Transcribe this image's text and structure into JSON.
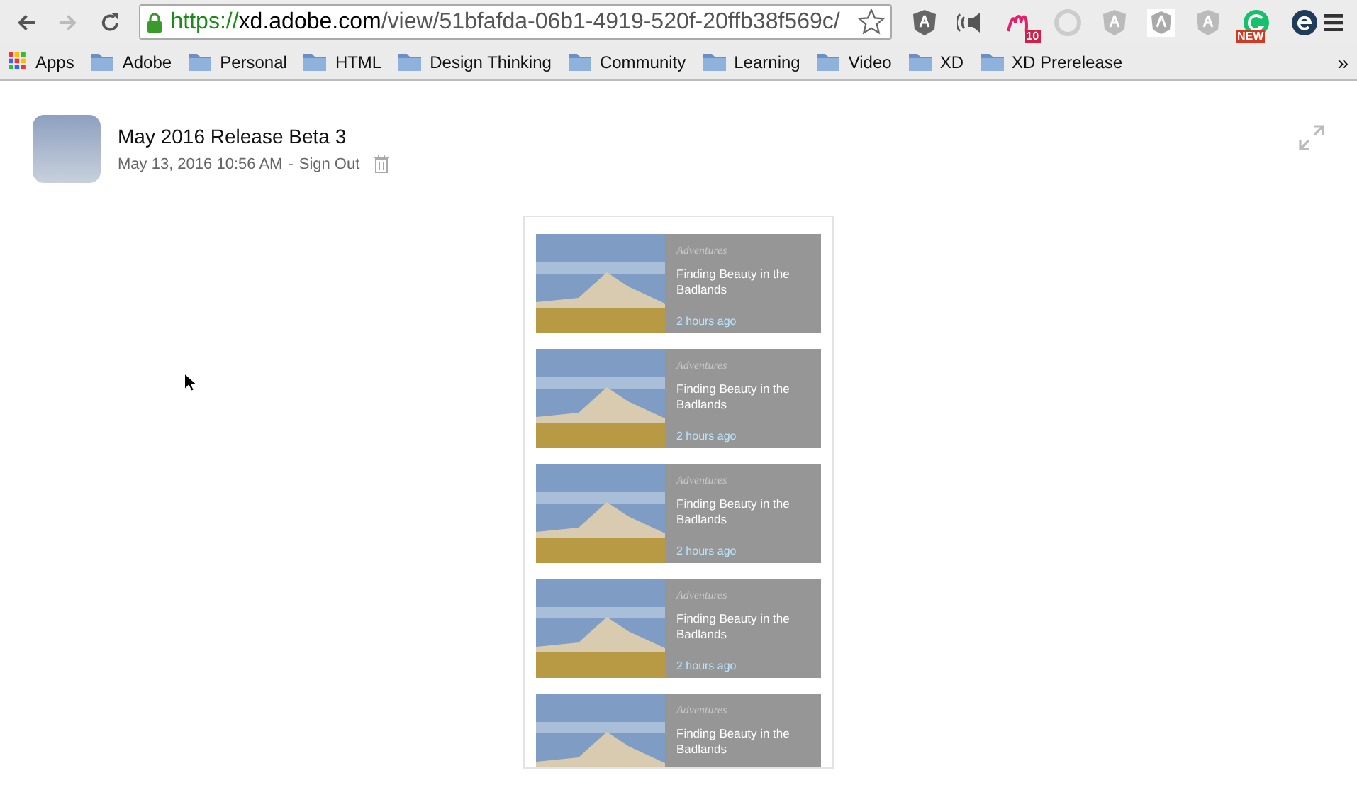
{
  "browser": {
    "url_scheme": "https://",
    "url_host": "xd.adobe.com",
    "url_path": "/view/51bfafda-06b1-4919-520f-20ffb38f569c/",
    "extensions": [
      {
        "kind": "shield"
      },
      {
        "kind": "speaker"
      },
      {
        "kind": "script",
        "badge": "10"
      },
      {
        "kind": "sync"
      },
      {
        "kind": "shield-faint"
      },
      {
        "kind": "shield-box"
      },
      {
        "kind": "shield-faint"
      },
      {
        "kind": "grammar",
        "badge": "NEW"
      },
      {
        "kind": "circle-e"
      }
    ],
    "bookmarks": [
      {
        "label": "Apps",
        "kind": "apps"
      },
      {
        "label": "Adobe",
        "kind": "folder"
      },
      {
        "label": "Personal",
        "kind": "folder"
      },
      {
        "label": "HTML",
        "kind": "folder"
      },
      {
        "label": "Design Thinking",
        "kind": "folder"
      },
      {
        "label": "Community",
        "kind": "folder"
      },
      {
        "label": "Learning",
        "kind": "folder"
      },
      {
        "label": "Video",
        "kind": "folder"
      },
      {
        "label": "XD",
        "kind": "folder"
      },
      {
        "label": "XD Prerelease",
        "kind": "folder"
      }
    ],
    "overflow": "»"
  },
  "header": {
    "title": "May 2016 Release Beta 3",
    "date": "May 13, 2016 10:56 AM",
    "separator": "-",
    "sign_out": "Sign Out"
  },
  "cards": [
    {
      "category": "Adventures",
      "title": "Finding Beauty in the Badlands",
      "time": "2 hours ago"
    },
    {
      "category": "Adventures",
      "title": "Finding Beauty in the Badlands",
      "time": "2 hours ago"
    },
    {
      "category": "Adventures",
      "title": "Finding Beauty in the Badlands",
      "time": "2 hours ago"
    },
    {
      "category": "Adventures",
      "title": "Finding Beauty in the Badlands",
      "time": "2 hours ago"
    },
    {
      "category": "Adventures",
      "title": "Finding Beauty in the Badlands"
    }
  ]
}
